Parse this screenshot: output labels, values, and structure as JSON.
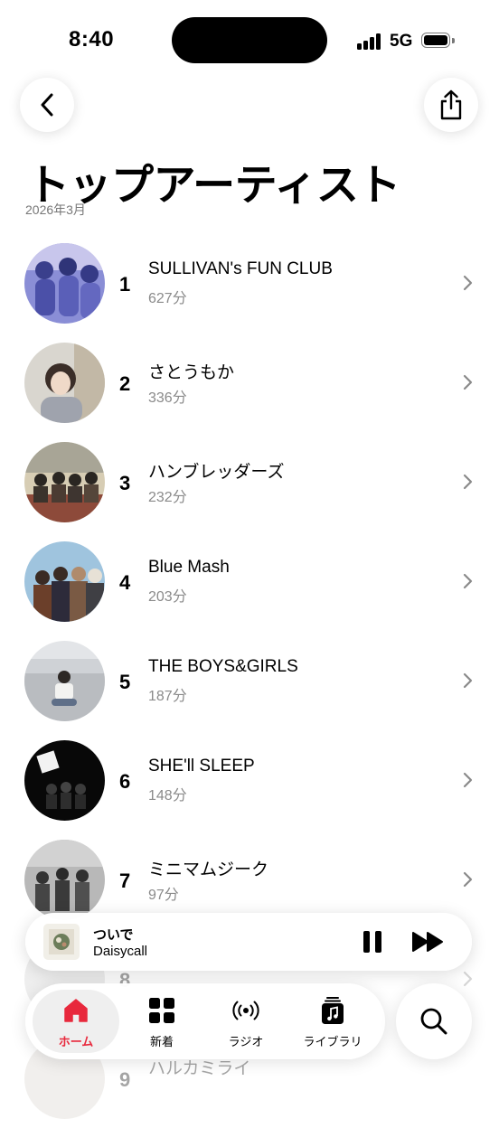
{
  "status": {
    "time": "8:40",
    "network": "5G"
  },
  "header": {
    "title": "トップアーティスト",
    "subtitle": "2026年3月",
    "back_icon": "chevron-left-icon",
    "share_icon": "share-icon"
  },
  "artists": [
    {
      "rank": "1",
      "name": "SULLIVAN's FUN CLUB",
      "minutes": "627分"
    },
    {
      "rank": "2",
      "name": "さとうもか",
      "minutes": "336分"
    },
    {
      "rank": "3",
      "name": "ハンブレッダーズ",
      "minutes": "232分"
    },
    {
      "rank": "4",
      "name": "Blue Mash",
      "minutes": "203分"
    },
    {
      "rank": "5",
      "name": "THE BOYS&GIRLS",
      "minutes": "187分"
    },
    {
      "rank": "6",
      "name": "SHE'll SLEEP",
      "minutes": "148分"
    },
    {
      "rank": "7",
      "name": "ミニマムジーク",
      "minutes": "97分"
    },
    {
      "rank": "8",
      "name": "",
      "minutes": ""
    },
    {
      "rank": "9",
      "name": "ハルカミライ",
      "minutes": ""
    }
  ],
  "now_playing": {
    "title": "ついで",
    "artist": "Daisycall",
    "progress": 0,
    "playing": true
  },
  "tabs": [
    {
      "label": "ホーム",
      "icon": "home-icon",
      "selected": true
    },
    {
      "label": "新着",
      "icon": "grid-icon",
      "selected": false
    },
    {
      "label": "ラジオ",
      "icon": "radio-icon",
      "selected": false
    },
    {
      "label": "ライブラリ",
      "icon": "library-icon",
      "selected": false
    }
  ],
  "colors": {
    "accent": "#e8283c",
    "secondary_text": "#8a8a8a"
  }
}
